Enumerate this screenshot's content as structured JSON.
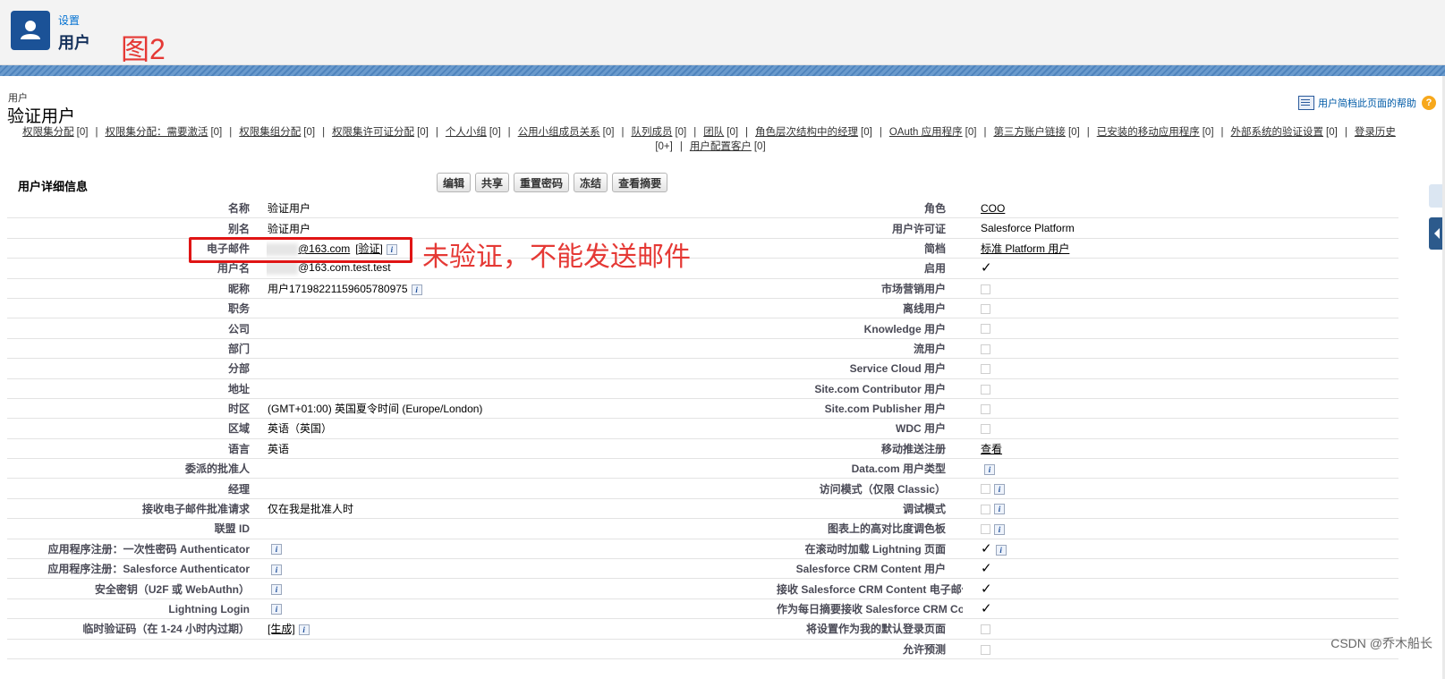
{
  "header": {
    "breadcrumb": "设置",
    "title": "用户",
    "annotation": "图2"
  },
  "page": {
    "object_label": "用户",
    "record_title": "验证用户",
    "help_link": "用户简档此页面的帮助",
    "help_icon": "?"
  },
  "related_links": [
    {
      "label": "权限集分配",
      "count": "[0]"
    },
    {
      "label": "权限集分配：需要激活",
      "count": "[0]"
    },
    {
      "label": "权限集组分配",
      "count": "[0]"
    },
    {
      "label": "权限集许可证分配",
      "count": "[0]"
    },
    {
      "label": "个人小组",
      "count": "[0]"
    },
    {
      "label": "公用小组成员关系",
      "count": "[0]"
    },
    {
      "label": "队列成员",
      "count": "[0]"
    },
    {
      "label": "团队",
      "count": "[0]"
    },
    {
      "label": "角色层次结构中的经理",
      "count": "[0]"
    },
    {
      "label": "OAuth 应用程序",
      "count": "[0]"
    },
    {
      "label": "第三方账户链接",
      "count": "[0]"
    },
    {
      "label": "已安装的移动应用程序",
      "count": "[0]"
    },
    {
      "label": "外部系统的验证设置",
      "count": "[0]"
    },
    {
      "label": "登录历史",
      "count": "[0+]"
    },
    {
      "label": "用户配置客户",
      "count": "[0]"
    }
  ],
  "related_separator": "|",
  "section": {
    "title": "用户详细信息"
  },
  "buttons": [
    "编辑",
    "共享",
    "重置密码",
    "冻结",
    "查看摘要"
  ],
  "info_glyph": "i",
  "check_glyph": "✓",
  "left_rows": [
    {
      "label": "名称",
      "value": "验证用户",
      "link": "",
      "suffix": "",
      "info": false
    },
    {
      "label": "别名",
      "value": "验证用户",
      "link": "",
      "suffix": "",
      "info": false
    },
    {
      "label": "电子邮件",
      "value": "",
      "link": "@163.com",
      "suffix": "[验证]",
      "info": true,
      "blur": true
    },
    {
      "label": "用户名",
      "value": "@163.com.test.test",
      "link": "",
      "suffix": "",
      "info": false,
      "blur": true
    },
    {
      "label": "昵称",
      "value": "用户17198221159605780975",
      "link": "",
      "suffix": "",
      "info": true
    },
    {
      "label": "职务",
      "value": "",
      "link": "",
      "suffix": "",
      "info": false
    },
    {
      "label": "公司",
      "value": "",
      "link": "",
      "suffix": "",
      "info": false
    },
    {
      "label": "部门",
      "value": "",
      "link": "",
      "suffix": "",
      "info": false
    },
    {
      "label": "分部",
      "value": "",
      "link": "",
      "suffix": "",
      "info": false
    },
    {
      "label": "地址",
      "value": "",
      "link": "",
      "suffix": "",
      "info": false
    },
    {
      "label": "时区",
      "value": "(GMT+01:00) 英国夏令时间 (Europe/London)",
      "link": "",
      "suffix": "",
      "info": false
    },
    {
      "label": "区域",
      "value": "英语（英国）",
      "link": "",
      "suffix": "",
      "info": false
    },
    {
      "label": "语言",
      "value": "英语",
      "link": "",
      "suffix": "",
      "info": false
    },
    {
      "label": "委派的批准人",
      "value": "",
      "link": "",
      "suffix": "",
      "info": false
    },
    {
      "label": "经理",
      "value": "",
      "link": "",
      "suffix": "",
      "info": false
    },
    {
      "label": "接收电子邮件批准请求",
      "value": "仅在我是批准人时",
      "link": "",
      "suffix": "",
      "info": false
    },
    {
      "label": "联盟 ID",
      "value": "",
      "link": "",
      "suffix": "",
      "info": false
    },
    {
      "label": "应用程序注册：一次性密码 Authenticator",
      "value": "",
      "link": "",
      "suffix": "",
      "info": true
    },
    {
      "label": "应用程序注册：Salesforce Authenticator",
      "value": "",
      "link": "",
      "suffix": "",
      "info": true
    },
    {
      "label": "安全密钥（U2F 或 WebAuthn）",
      "value": "",
      "link": "",
      "suffix": "",
      "info": true
    },
    {
      "label": "Lightning Login",
      "value": "",
      "link": "",
      "suffix": "",
      "info": true
    },
    {
      "label": "临时验证码（在 1-24 小时内过期）",
      "value": "",
      "link": "[生成]",
      "suffix": "",
      "info": true
    },
    {
      "label": "",
      "value": "",
      "link": "",
      "suffix": "",
      "info": false
    }
  ],
  "right_rows": [
    {
      "label": "角色",
      "type": "link",
      "value": "COO",
      "info": false
    },
    {
      "label": "用户许可证",
      "type": "text",
      "value": "Salesforce Platform",
      "info": false
    },
    {
      "label": "简档",
      "type": "link",
      "value": "标准 Platform 用户",
      "info": false
    },
    {
      "label": "启用",
      "type": "check",
      "value": "true",
      "info": false
    },
    {
      "label": "市场营销用户",
      "type": "box",
      "value": "false",
      "info": false
    },
    {
      "label": "离线用户",
      "type": "box",
      "value": "false",
      "info": false
    },
    {
      "label": "Knowledge 用户",
      "type": "box",
      "value": "false",
      "info": false
    },
    {
      "label": "流用户",
      "type": "box",
      "value": "false",
      "info": false
    },
    {
      "label": "Service Cloud 用户",
      "type": "box",
      "value": "false",
      "info": false
    },
    {
      "label": "Site.com Contributor 用户",
      "type": "box",
      "value": "false",
      "info": false
    },
    {
      "label": "Site.com Publisher 用户",
      "type": "box",
      "value": "false",
      "info": false
    },
    {
      "label": "WDC 用户",
      "type": "box",
      "value": "false",
      "info": false
    },
    {
      "label": "移动推送注册",
      "type": "link",
      "value": "查看",
      "info": false
    },
    {
      "label": "Data.com 用户类型",
      "type": "text",
      "value": "",
      "info": true
    },
    {
      "label": "访问模式（仅限 Classic）",
      "type": "box",
      "value": "false",
      "info": true
    },
    {
      "label": "调试模式",
      "type": "box",
      "value": "false",
      "info": true
    },
    {
      "label": "图表上的高对比度调色板",
      "type": "box",
      "value": "false",
      "info": true
    },
    {
      "label": "在滚动时加载 Lightning 页面",
      "type": "check",
      "value": "true",
      "info": true
    },
    {
      "label": "Salesforce CRM Content 用户",
      "type": "check",
      "value": "true",
      "info": false
    },
    {
      "label": "接收 Salesforce CRM Content 电子邮件提醒",
      "type": "check",
      "value": "true",
      "info": false
    },
    {
      "label": "作为每日摘要接收 Salesforce CRM Content 警告",
      "type": "check",
      "value": "true",
      "info": false
    },
    {
      "label": "将设置作为我的默认登录页面",
      "type": "box",
      "value": "false",
      "info": false
    },
    {
      "label": "允许预测",
      "type": "box",
      "value": "false",
      "info": false
    }
  ],
  "annotations": {
    "red_note": "未验证，不能发送邮件"
  },
  "watermark": "CSDN @乔木船长",
  "colors": {
    "brand": "#1b5297",
    "annotation": "#e53935",
    "band": "#5a8ec4"
  }
}
